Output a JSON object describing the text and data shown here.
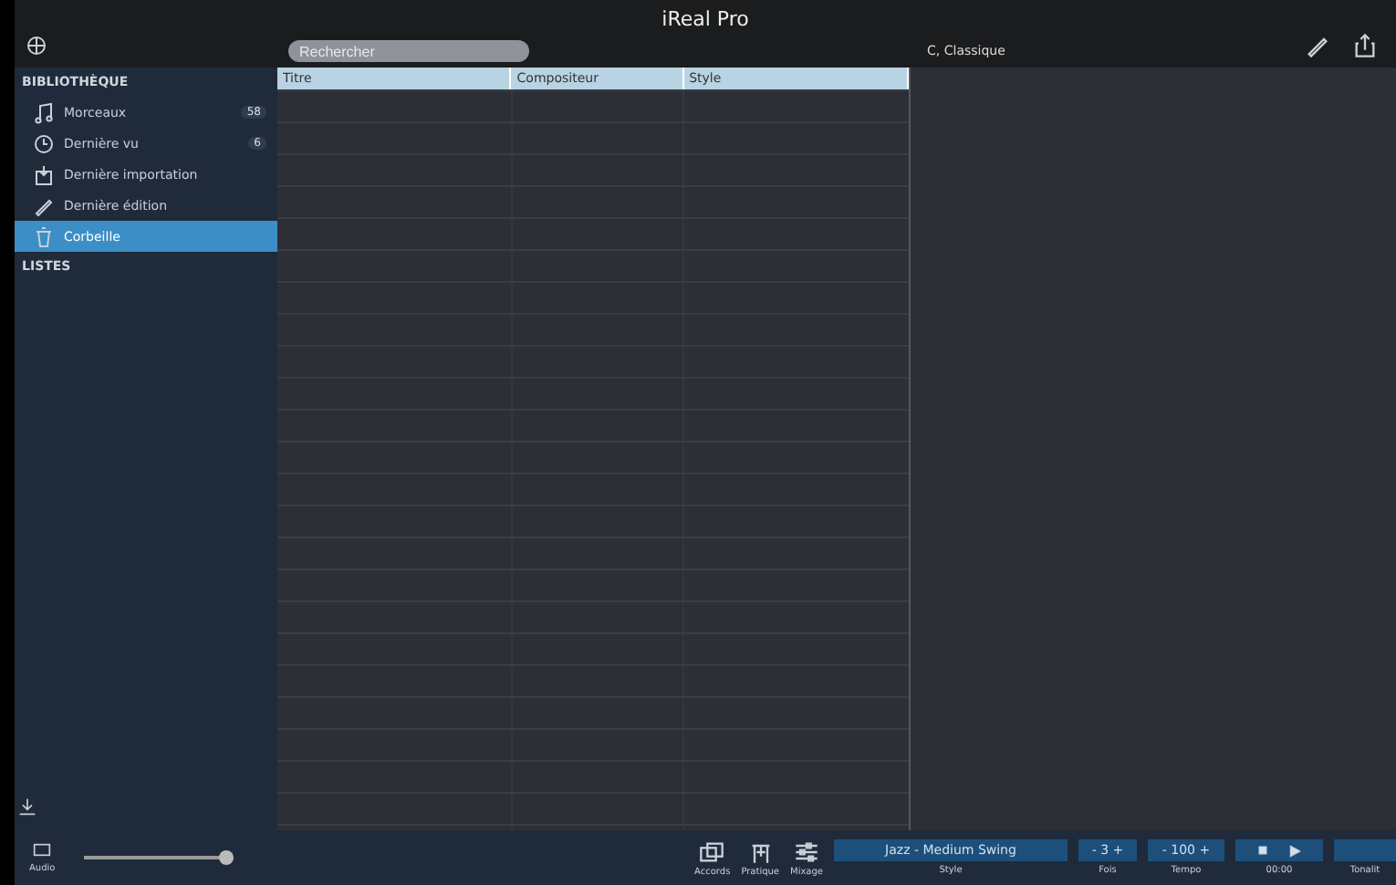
{
  "window": {
    "title": "iReal Pro"
  },
  "search": {
    "placeholder": "Rechercher"
  },
  "detail_header": {
    "key": "C,",
    "style": "Classique"
  },
  "sidebar": {
    "sections": [
      {
        "title": "BIBLIOTHÈQUE",
        "items": [
          {
            "label": "Morceaux",
            "kind": "note",
            "badge": "58",
            "selected": false
          },
          {
            "label": "Dernière vu",
            "kind": "clock",
            "badge": "6",
            "selected": false
          },
          {
            "label": "Dernière importation",
            "kind": "import",
            "selected": false
          },
          {
            "label": "Dernière édition",
            "kind": "pencil",
            "selected": false
          },
          {
            "label": "Corbeille",
            "kind": "trash",
            "selected": true
          }
        ]
      },
      {
        "title": "LISTES"
      }
    ]
  },
  "table": {
    "columns": [
      "Titre",
      "Compositeur",
      "Style"
    ]
  },
  "bottom_bar": {
    "audio_label": "Audio",
    "volume": {
      "level": 1
    },
    "tools": [
      {
        "label": "Accords",
        "kind": "chords"
      },
      {
        "label": "Pratique",
        "kind": "practice"
      },
      {
        "label": "Mixage",
        "kind": "mixer"
      }
    ],
    "style": {
      "value": "Jazz - Medium Swing",
      "label": "Style"
    },
    "repeats": {
      "minus": "-",
      "value": "3",
      "plus": "+",
      "label": "Fois"
    },
    "tempo": {
      "minus": "-",
      "value": "100",
      "plus": "+",
      "label": "Tempo"
    },
    "player": {
      "time": "00:00"
    },
    "key_label": "Tonalit"
  }
}
